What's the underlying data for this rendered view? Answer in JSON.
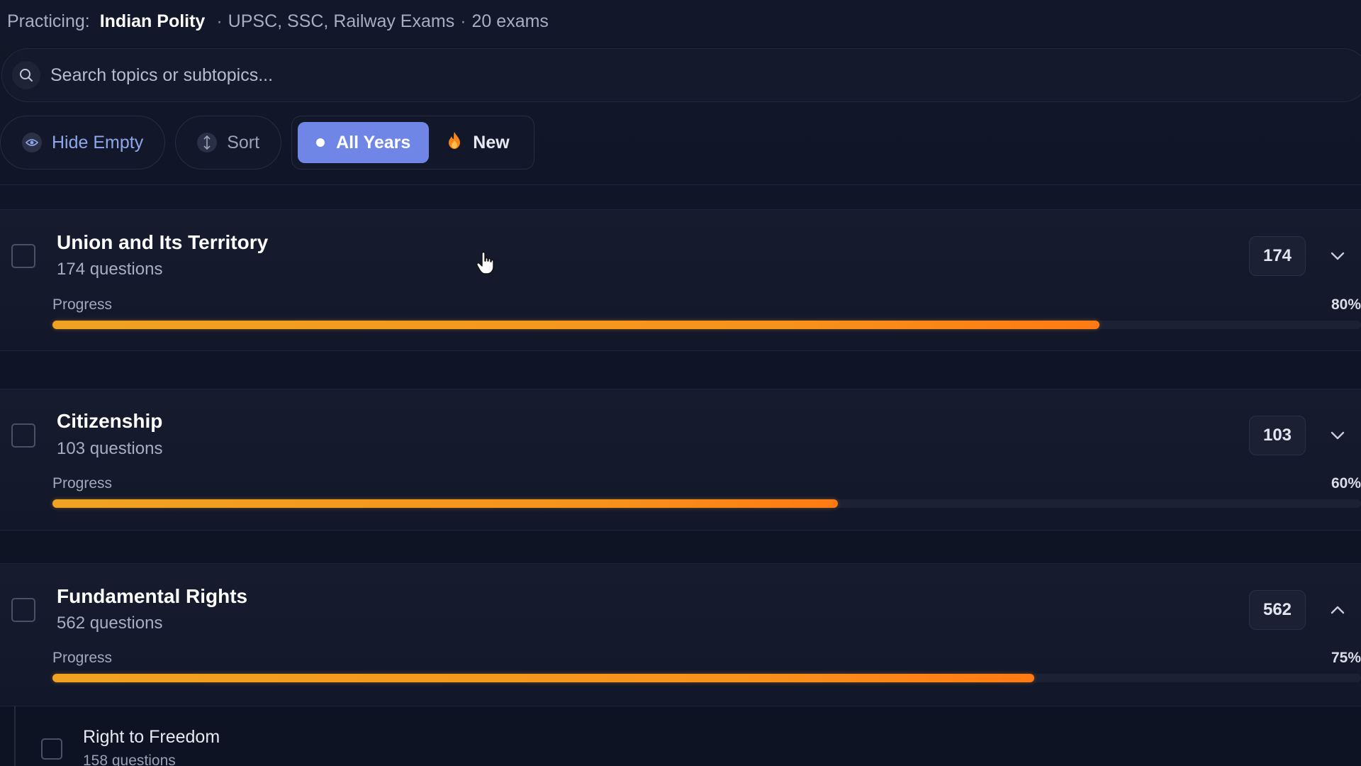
{
  "context": {
    "label": "Practicing:",
    "subject": "Indian Polity",
    "separator": "·",
    "exams": "UPSC, SSC, Railway Exams",
    "exam_count": "20 exams"
  },
  "search": {
    "placeholder": "Search topics or subtopics..."
  },
  "filters": {
    "hide_empty": "Hide Empty",
    "sort": "Sort",
    "all_years": "All Years",
    "new": "New"
  },
  "topics": [
    {
      "title": "Union and Its Territory",
      "count": "174 questions",
      "badge": "174",
      "progress_label": "Progress",
      "progress_text": "80%",
      "progress": 0.8,
      "expanded": false
    },
    {
      "title": "Citizenship",
      "count": "103 questions",
      "badge": "103",
      "progress_label": "Progress",
      "progress_text": "60%",
      "progress": 0.6,
      "expanded": false
    },
    {
      "title": "Fundamental Rights",
      "count": "562 questions",
      "badge": "562",
      "progress_label": "Progress",
      "progress_text": "75%",
      "progress": 0.75,
      "expanded": true
    }
  ],
  "subtopics": [
    {
      "title": "Right to Freedom",
      "count": "158 questions"
    }
  ],
  "colors": {
    "accent": "#6f86e6",
    "progress": "#f7921c",
    "background": "#0f1423"
  },
  "icons": {
    "search": "search-icon",
    "hide_empty": "eye-icon",
    "sort": "sort-icon",
    "new": "flame-icon",
    "collapsed": "chevron-down-icon",
    "expanded": "chevron-up-icon"
  }
}
